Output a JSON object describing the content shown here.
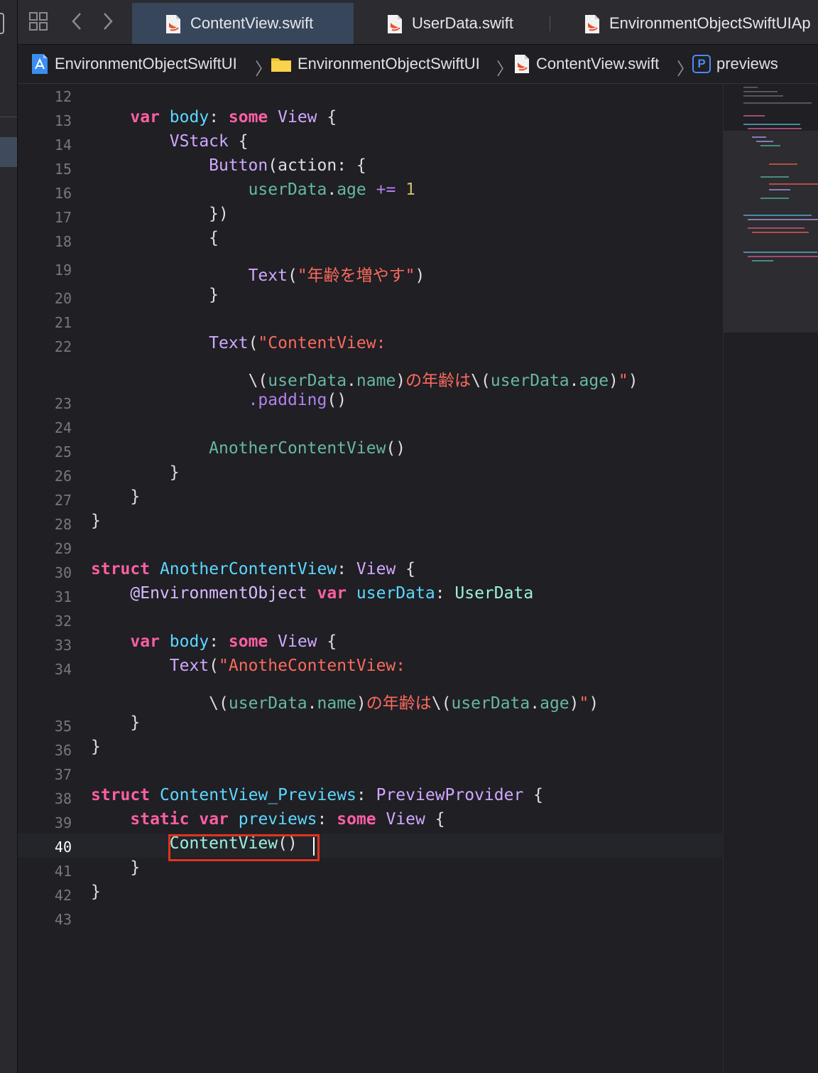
{
  "tabs": [
    {
      "label": "ContentView.swift",
      "active": true
    },
    {
      "label": "UserData.swift",
      "active": false
    },
    {
      "label": "EnvironmentObjectSwiftUIAp",
      "active": false
    }
  ],
  "breadcrumbs": [
    "EnvironmentObjectSwiftUI",
    "EnvironmentObjectSwiftUI",
    "ContentView.swift",
    "previews"
  ],
  "breadcrumb_badge": "P",
  "line_numbers": [
    "12",
    "13",
    "14",
    "15",
    "16",
    "17",
    "18",
    "19",
    "20",
    "21",
    "22",
    "23",
    "24",
    "25",
    "26",
    "27",
    "28",
    "29",
    "30",
    "31",
    "32",
    "33",
    "34",
    "35",
    "36",
    "37",
    "38",
    "39",
    "40",
    "41",
    "42",
    "43"
  ],
  "current_line": "40",
  "code": {
    "l13": {
      "k1": "var",
      "id": "body",
      "p1": ": ",
      "k2": "some",
      "ty": "View",
      "p2": " {"
    },
    "l14": {
      "ty": "VStack",
      "p": " {"
    },
    "l15": {
      "f": "Button",
      "p": "(action: {"
    },
    "l16": {
      "u1": "userData",
      "p": ".",
      "u2": "age",
      "op": " += ",
      "num": "1"
    },
    "l17": {
      "p": "})"
    },
    "l18": {
      "p": "{"
    },
    "l19": {
      "f": "Text",
      "p1": "(",
      "s": "\"年齢を増やす\"",
      "p2": ")"
    },
    "l20": {
      "p": "}"
    },
    "l22": {
      "f": "Text",
      "p": "(",
      "s": "\"ContentView:"
    },
    "l22b": {
      "p1": "\\(",
      "u1": "userData",
      "d1": ".",
      "u2": "name",
      "p2": ")",
      "s1": "の年齢は",
      "p3": "\\(",
      "u3": "userData",
      "d2": ".",
      "u4": "age",
      "p4": ")",
      "s2": "\"",
      "p5": ")"
    },
    "l23": {
      "m": ".padding",
      "p": "()"
    },
    "l25": {
      "f": "AnotherContentView",
      "p": "()"
    },
    "l26": {
      "p": "}"
    },
    "l27": {
      "p": "}"
    },
    "l28": {
      "p": "}"
    },
    "l30": {
      "k": "struct",
      "d": "AnotherContentView",
      "p1": ": ",
      "ty": "View",
      "p2": " {"
    },
    "l31": {
      "at": "@EnvironmentObject",
      "sp": " ",
      "k": "var",
      "d": "userData",
      "p": ": ",
      "ty": "UserData"
    },
    "l33": {
      "k1": "var",
      "id": "body",
      "p1": ": ",
      "k2": "some",
      "ty": "View",
      "p2": " {"
    },
    "l34": {
      "f": "Text",
      "p": "(",
      "s": "\"AnotheContentView:"
    },
    "l34b": {
      "p1": "\\(",
      "u1": "userData",
      "d1": ".",
      "u2": "name",
      "p2": ")",
      "s1": "の年齢は",
      "p3": "\\(",
      "u3": "userData",
      "d2": ".",
      "u4": "age",
      "p4": ")",
      "s2": "\"",
      "p5": ")"
    },
    "l35": {
      "p": "}"
    },
    "l36": {
      "p": "}"
    },
    "l38": {
      "k": "struct",
      "d": "ContentView_Previews",
      "p1": ": ",
      "ty": "PreviewProvider",
      "p2": " {"
    },
    "l39": {
      "k1": "static",
      "k2": "var",
      "d": "previews",
      "p1": ": ",
      "k3": "some",
      "ty": "View",
      "p2": " {"
    },
    "l40": {
      "f": "ContentView",
      "p": "()"
    },
    "l41": {
      "p": "}"
    },
    "l42": {
      "p": "}"
    }
  },
  "colors": {
    "keyword": "#fc5fa3",
    "string": "#fc6a5d",
    "type": "#d0a8ff",
    "function": "#67b7a4",
    "property": "#9ef1dd",
    "declaration": "#5dd8ff",
    "number": "#d0bf69",
    "highlight_box": "#e0341c",
    "active_tab": "#37465a"
  },
  "icons": {
    "grid": "grid-icon",
    "back": "chevron-left-icon",
    "forward": "chevron-right-icon",
    "swift_file": "swift-file-icon",
    "project": "xcode-project-icon",
    "folder": "folder-icon"
  }
}
